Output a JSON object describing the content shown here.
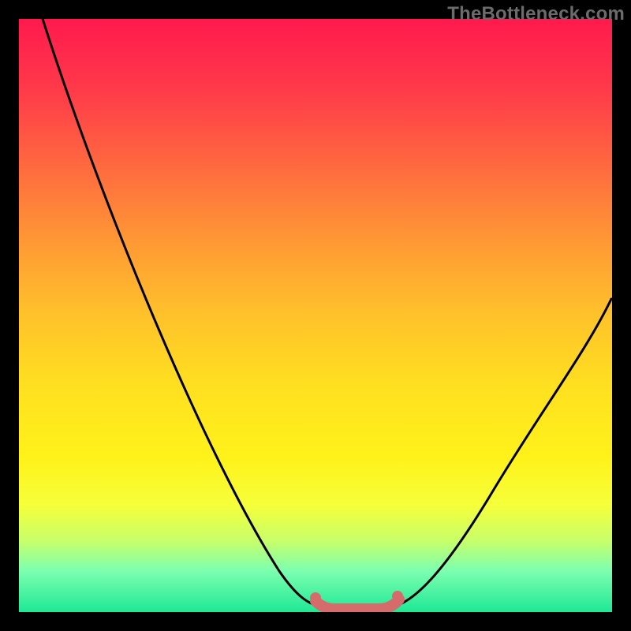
{
  "watermark": {
    "text": "TheBottleneck.com"
  },
  "colors": {
    "page_bg": "#000000",
    "curve": "#000000",
    "marker": "#d66b6b",
    "gradient_top": "#ff1a4d",
    "gradient_bottom": "#1ee895"
  },
  "chart_data": {
    "type": "line",
    "title": "",
    "xlabel": "",
    "ylabel": "",
    "xlim": [
      0,
      100
    ],
    "ylim": [
      0,
      100
    ],
    "grid": false,
    "note": "Axes are unlabeled in the source image. x and y expressed as 0-100 percent of the plot area; y is bottleneck percentage (0 = no bottleneck / green, 100 = severe / red).",
    "series": [
      {
        "name": "bottleneck-curve",
        "x": [
          4,
          8,
          12,
          16,
          20,
          24,
          28,
          32,
          36,
          40,
          44,
          48,
          50,
          52,
          54,
          56,
          58,
          60,
          62,
          66,
          70,
          74,
          78,
          82,
          86,
          90,
          94,
          98,
          100
        ],
        "y": [
          100,
          92,
          84,
          76,
          68,
          60,
          52,
          44,
          36,
          28,
          20,
          10,
          4,
          1,
          0,
          0,
          0,
          0,
          1,
          4,
          9,
          14,
          20,
          26,
          32,
          38,
          44,
          50,
          53
        ]
      }
    ],
    "optimal_range": {
      "name": "near-zero-band",
      "x": [
        50,
        52,
        54,
        56,
        58,
        60,
        62
      ],
      "y": [
        2,
        1,
        0.5,
        0.5,
        0.5,
        1,
        2
      ]
    }
  }
}
